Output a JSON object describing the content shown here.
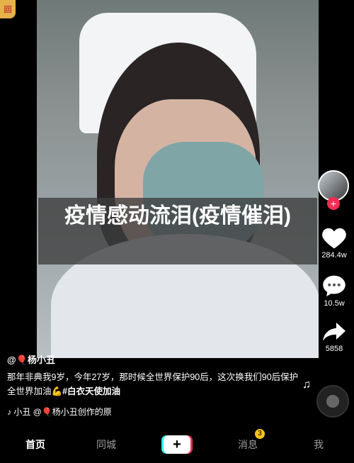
{
  "video": {
    "overlay_title": "疫情感动流泪(疫情催泪)",
    "corner_badge": "回"
  },
  "sidebar": {
    "likes": "284.4w",
    "comments": "10.5w",
    "shares": "5858",
    "follow_symbol": "+"
  },
  "post": {
    "author": "@🎈杨小丑",
    "description": "那年非典我9岁，今年27岁，那时候全世界保护90后，这次换我们90后保护全世界加油💪",
    "hashtag": "#白衣天使加油",
    "music": "♪ 小丑    @🎈杨小丑创作的原"
  },
  "nav": {
    "home": "首页",
    "city": "同城",
    "add": "+",
    "messages": "消息",
    "messages_badge": "3",
    "me": "我"
  },
  "colors": {
    "accent_red": "#fe2c55",
    "accent_cyan": "#25f4ee",
    "badge_yellow": "#f5c518"
  }
}
